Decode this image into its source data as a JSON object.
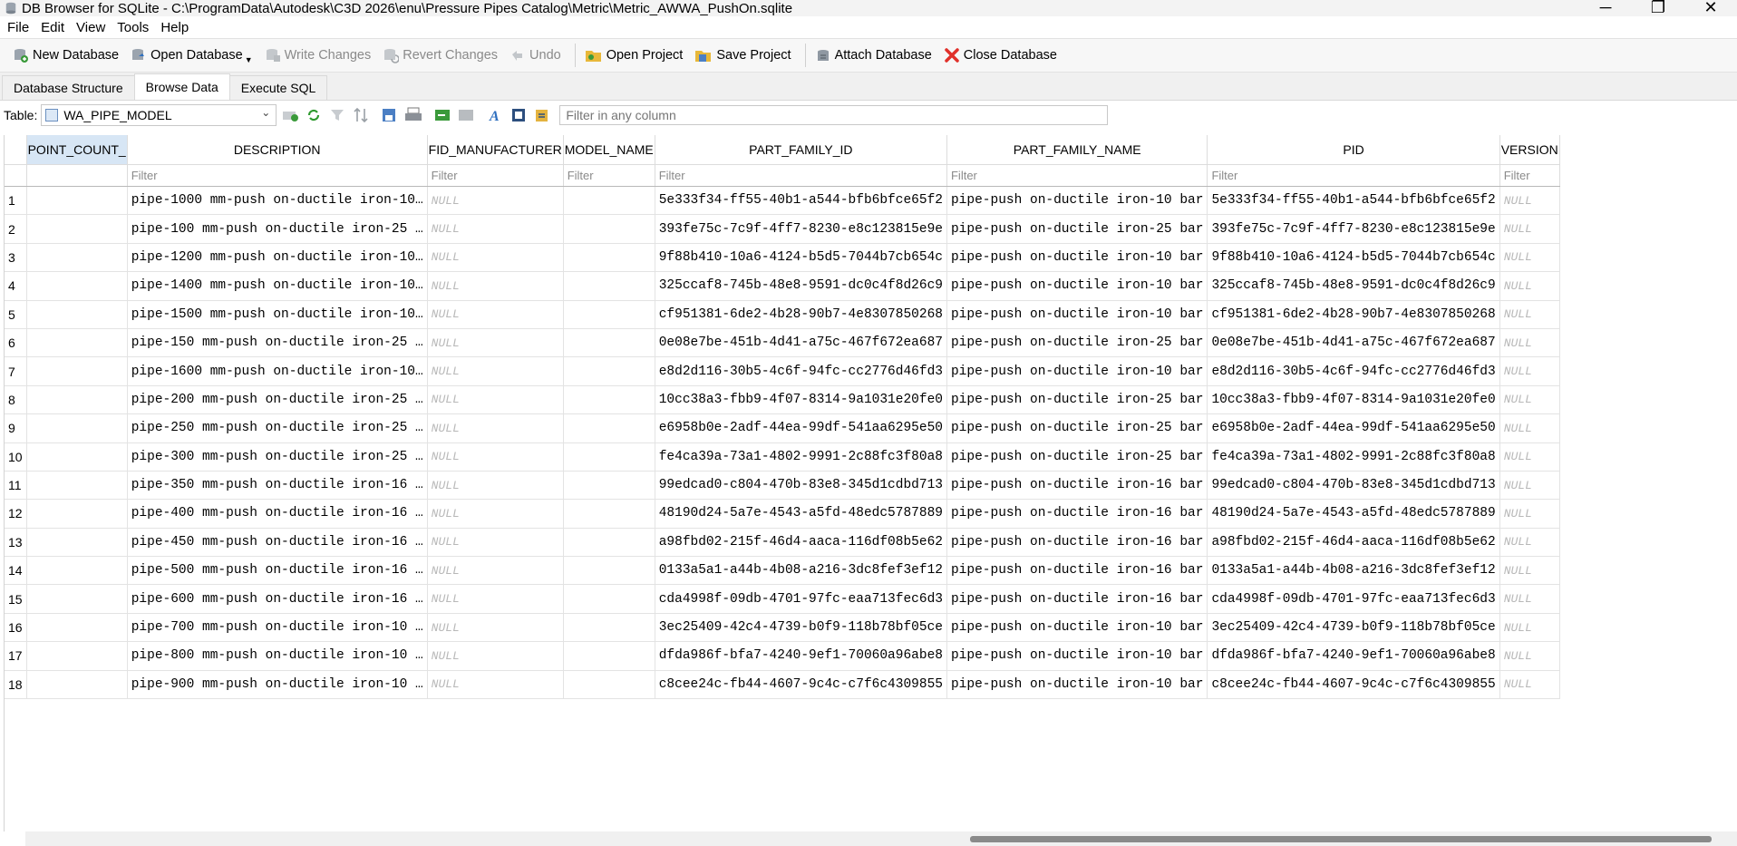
{
  "window": {
    "title": "DB Browser for SQLite - C:\\ProgramData\\Autodesk\\C3D 2026\\enu\\Pressure Pipes Catalog\\Metric\\Metric_AWWA_PushOn.sqlite",
    "minimize": "─",
    "maximize": "❐",
    "close": "✕"
  },
  "menu": [
    "File",
    "Edit",
    "View",
    "Tools",
    "Help"
  ],
  "toolbar": {
    "new_database": "New Database",
    "open_database": "Open Database",
    "write_changes": "Write Changes",
    "revert_changes": "Revert Changes",
    "undo": "Undo",
    "open_project": "Open Project",
    "save_project": "Save Project",
    "attach_database": "Attach Database",
    "close_database": "Close Database"
  },
  "tabs": [
    "Database Structure",
    "Browse Data",
    "Execute SQL"
  ],
  "active_tab": "Browse Data",
  "table_bar": {
    "label": "Table:",
    "selected_table": "WA_PIPE_MODEL",
    "filter_placeholder": "Filter in any column"
  },
  "grid": {
    "columns": [
      "_POINT_COUNT",
      "DESCRIPTION",
      "FID_MANUFACTURER",
      "MODEL_NAME",
      "PART_FAMILY_ID",
      "PART_FAMILY_NAME",
      "PID",
      "VERSION"
    ],
    "filter_placeholder": "Filter",
    "rows": [
      {
        "n": "1",
        "point_count": "",
        "description": "pipe-1000 mm-push on-ductile iron-10…",
        "fid": "NULL",
        "model": "",
        "pf_id": "5e333f34-ff55-40b1-a544-bfb6bfce65f2",
        "pf_name": "pipe-push on-ductile iron-10 bar",
        "pid": "5e333f34-ff55-40b1-a544-bfb6bfce65f2",
        "version": "NULL"
      },
      {
        "n": "2",
        "point_count": "",
        "description": "pipe-100 mm-push on-ductile iron-25 …",
        "fid": "NULL",
        "model": "",
        "pf_id": "393fe75c-7c9f-4ff7-8230-e8c123815e9e",
        "pf_name": "pipe-push on-ductile iron-25 bar",
        "pid": "393fe75c-7c9f-4ff7-8230-e8c123815e9e",
        "version": "NULL"
      },
      {
        "n": "3",
        "point_count": "",
        "description": "pipe-1200 mm-push on-ductile iron-10…",
        "fid": "NULL",
        "model": "",
        "pf_id": "9f88b410-10a6-4124-b5d5-7044b7cb654c",
        "pf_name": "pipe-push on-ductile iron-10 bar",
        "pid": "9f88b410-10a6-4124-b5d5-7044b7cb654c",
        "version": "NULL"
      },
      {
        "n": "4",
        "point_count": "",
        "description": "pipe-1400 mm-push on-ductile iron-10…",
        "fid": "NULL",
        "model": "",
        "pf_id": "325ccaf8-745b-48e8-9591-dc0c4f8d26c9",
        "pf_name": "pipe-push on-ductile iron-10 bar",
        "pid": "325ccaf8-745b-48e8-9591-dc0c4f8d26c9",
        "version": "NULL"
      },
      {
        "n": "5",
        "point_count": "",
        "description": "pipe-1500 mm-push on-ductile iron-10…",
        "fid": "NULL",
        "model": "",
        "pf_id": "cf951381-6de2-4b28-90b7-4e8307850268",
        "pf_name": "pipe-push on-ductile iron-10 bar",
        "pid": "cf951381-6de2-4b28-90b7-4e8307850268",
        "version": "NULL"
      },
      {
        "n": "6",
        "point_count": "",
        "description": "pipe-150 mm-push on-ductile iron-25 …",
        "fid": "NULL",
        "model": "",
        "pf_id": "0e08e7be-451b-4d41-a75c-467f672ea687",
        "pf_name": "pipe-push on-ductile iron-25 bar",
        "pid": "0e08e7be-451b-4d41-a75c-467f672ea687",
        "version": "NULL"
      },
      {
        "n": "7",
        "point_count": "",
        "description": "pipe-1600 mm-push on-ductile iron-10…",
        "fid": "NULL",
        "model": "",
        "pf_id": "e8d2d116-30b5-4c6f-94fc-cc2776d46fd3",
        "pf_name": "pipe-push on-ductile iron-10 bar",
        "pid": "e8d2d116-30b5-4c6f-94fc-cc2776d46fd3",
        "version": "NULL"
      },
      {
        "n": "8",
        "point_count": "",
        "description": "pipe-200 mm-push on-ductile iron-25 …",
        "fid": "NULL",
        "model": "",
        "pf_id": "10cc38a3-fbb9-4f07-8314-9a1031e20fe0",
        "pf_name": "pipe-push on-ductile iron-25 bar",
        "pid": "10cc38a3-fbb9-4f07-8314-9a1031e20fe0",
        "version": "NULL"
      },
      {
        "n": "9",
        "point_count": "",
        "description": "pipe-250 mm-push on-ductile iron-25 …",
        "fid": "NULL",
        "model": "",
        "pf_id": "e6958b0e-2adf-44ea-99df-541aa6295e50",
        "pf_name": "pipe-push on-ductile iron-25 bar",
        "pid": "e6958b0e-2adf-44ea-99df-541aa6295e50",
        "version": "NULL"
      },
      {
        "n": "10",
        "point_count": "",
        "description": "pipe-300 mm-push on-ductile iron-25 …",
        "fid": "NULL",
        "model": "",
        "pf_id": "fe4ca39a-73a1-4802-9991-2c88fc3f80a8",
        "pf_name": "pipe-push on-ductile iron-25 bar",
        "pid": "fe4ca39a-73a1-4802-9991-2c88fc3f80a8",
        "version": "NULL"
      },
      {
        "n": "11",
        "point_count": "",
        "description": "pipe-350 mm-push on-ductile iron-16 …",
        "fid": "NULL",
        "model": "",
        "pf_id": "99edcad0-c804-470b-83e8-345d1cdbd713",
        "pf_name": "pipe-push on-ductile iron-16 bar",
        "pid": "99edcad0-c804-470b-83e8-345d1cdbd713",
        "version": "NULL"
      },
      {
        "n": "12",
        "point_count": "",
        "description": "pipe-400 mm-push on-ductile iron-16 …",
        "fid": "NULL",
        "model": "",
        "pf_id": "48190d24-5a7e-4543-a5fd-48edc5787889",
        "pf_name": "pipe-push on-ductile iron-16 bar",
        "pid": "48190d24-5a7e-4543-a5fd-48edc5787889",
        "version": "NULL"
      },
      {
        "n": "13",
        "point_count": "",
        "description": "pipe-450 mm-push on-ductile iron-16 …",
        "fid": "NULL",
        "model": "",
        "pf_id": "a98fbd02-215f-46d4-aaca-116df08b5e62",
        "pf_name": "pipe-push on-ductile iron-16 bar",
        "pid": "a98fbd02-215f-46d4-aaca-116df08b5e62",
        "version": "NULL"
      },
      {
        "n": "14",
        "point_count": "",
        "description": "pipe-500 mm-push on-ductile iron-16 …",
        "fid": "NULL",
        "model": "",
        "pf_id": "0133a5a1-a44b-4b08-a216-3dc8fef3ef12",
        "pf_name": "pipe-push on-ductile iron-16 bar",
        "pid": "0133a5a1-a44b-4b08-a216-3dc8fef3ef12",
        "version": "NULL"
      },
      {
        "n": "15",
        "point_count": "",
        "description": "pipe-600 mm-push on-ductile iron-16 …",
        "fid": "NULL",
        "model": "",
        "pf_id": "cda4998f-09db-4701-97fc-eaa713fec6d3",
        "pf_name": "pipe-push on-ductile iron-16 bar",
        "pid": "cda4998f-09db-4701-97fc-eaa713fec6d3",
        "version": "NULL"
      },
      {
        "n": "16",
        "point_count": "",
        "description": "pipe-700 mm-push on-ductile iron-10 …",
        "fid": "NULL",
        "model": "",
        "pf_id": "3ec25409-42c4-4739-b0f9-118b78bf05ce",
        "pf_name": "pipe-push on-ductile iron-10 bar",
        "pid": "3ec25409-42c4-4739-b0f9-118b78bf05ce",
        "version": "NULL"
      },
      {
        "n": "17",
        "point_count": "",
        "description": "pipe-800 mm-push on-ductile iron-10 …",
        "fid": "NULL",
        "model": "",
        "pf_id": "dfda986f-bfa7-4240-9ef1-70060a96abe8",
        "pf_name": "pipe-push on-ductile iron-10 bar",
        "pid": "dfda986f-bfa7-4240-9ef1-70060a96abe8",
        "version": "NULL"
      },
      {
        "n": "18",
        "point_count": "",
        "description": "pipe-900 mm-push on-ductile iron-10 …",
        "fid": "NULL",
        "model": "",
        "pf_id": "c8cee24c-fb44-4607-9c4c-c7f6c4309855",
        "pf_name": "pipe-push on-ductile iron-10 bar",
        "pid": "c8cee24c-fb44-4607-9c4c-c7f6c4309855",
        "version": "NULL"
      }
    ]
  },
  "colors": {
    "selected_header": "#d7e6f5",
    "null_text": "#b8b8b8",
    "close_db_icon": "#e0302a"
  }
}
